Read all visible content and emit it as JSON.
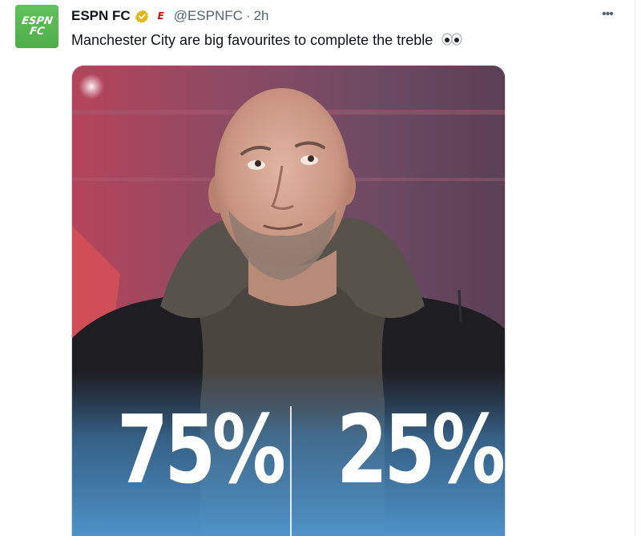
{
  "tweet": {
    "display_name": "ESPN FC",
    "handle": "@ESPNFC",
    "separator": "·",
    "time": "2h",
    "text": "Manchester City are big favourites to complete the treble",
    "more_label": "•••"
  },
  "avatar": {
    "line1": "ESPN",
    "line2": "FC",
    "color": "#5cb85c"
  },
  "affiliate_badge": {
    "letter": "E",
    "color": "#d50a0a"
  },
  "icons": {
    "verified": "verified-gold-icon",
    "eyes_emoji": "eyes-emoji-icon"
  },
  "media": {
    "stats": [
      {
        "value": "75%"
      },
      {
        "value": "25%"
      }
    ]
  },
  "colors": {
    "text": "#0f1419",
    "secondary": "#536471",
    "verified_gold": "#e2b719",
    "media_gradient_bottom": "#4f93c9"
  }
}
